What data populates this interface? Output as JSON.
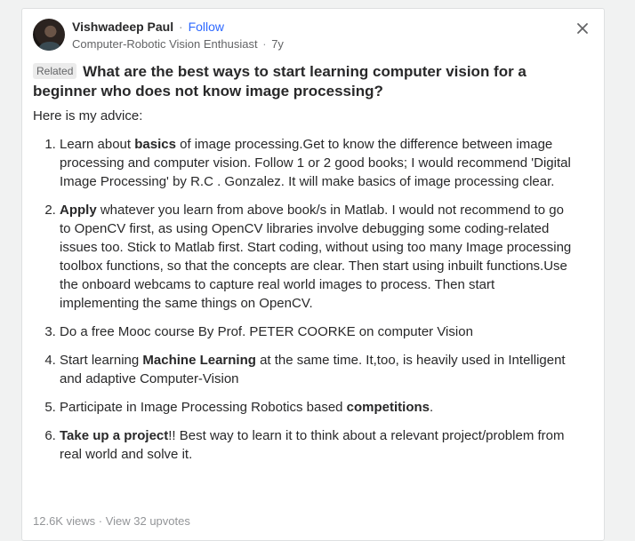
{
  "author": {
    "name": "Vishwadeep Paul",
    "separator": "·",
    "follow_label": "Follow",
    "credential": "Computer-Robotic Vision Enthusiast",
    "time": "7y"
  },
  "question": {
    "tag": "Related",
    "text": "What are the best ways to start learning computer vision for a beginner who does not know image processing?"
  },
  "answer": {
    "intro": "Here is my advice:",
    "items": [
      {
        "pre": "Learn about ",
        "bold": "basics",
        "post": " of image processing.Get to know the difference between image processing and computer vision. Follow 1 or 2 good books; I would recommend 'Digital Image Processing' by R.C . Gonzalez. It will make basics of image processing clear."
      },
      {
        "pre": "",
        "bold": "Apply",
        "post": " whatever you learn from above book/s in Matlab. I would not recommend to go to OpenCV first, as using OpenCV libraries involve debugging some coding-related issues too. Stick to Matlab first. Start coding, without using too many Image processing toolbox functions, so that the concepts are clear. Then start using inbuilt functions.Use the onboard webcams to capture real world images to process. Then start implementing the same things on OpenCV."
      },
      {
        "pre": "Do a free Mooc course By Prof. PETER COORKE on computer Vision",
        "bold": "",
        "post": ""
      },
      {
        "pre": "Start learning ",
        "bold": "Machine Learning",
        "post": " at the same time. It,too, is heavily used in Intelligent and adaptive Computer-Vision"
      },
      {
        "pre": "Participate in Image Processing Robotics based ",
        "bold": "competitions",
        "post": "."
      },
      {
        "pre": "",
        "bold": "Take up a project",
        "post": "!! Best way to learn it to think about a relevant project/problem from real world and solve it."
      }
    ]
  },
  "footer": {
    "views": "12.6K views",
    "separator": "·",
    "upvotes": "View 32 upvotes"
  },
  "icons": {
    "close": "close-icon"
  }
}
